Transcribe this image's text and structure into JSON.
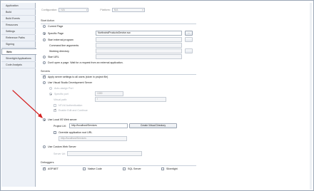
{
  "sidebar": {
    "items": [
      {
        "label": "Application"
      },
      {
        "label": "Build"
      },
      {
        "label": "Build Events"
      },
      {
        "label": "Resources"
      },
      {
        "label": "Settings"
      },
      {
        "label": "Reference Paths"
      },
      {
        "label": "Signing"
      },
      {
        "label": "Web"
      },
      {
        "label": "Silverlight Applications"
      },
      {
        "label": "Code Analysis"
      }
    ],
    "active_index": 7
  },
  "topbar": {
    "configuration_label": "Configuration:",
    "configuration_value": "N/A",
    "platform_label": "Platform:",
    "platform_value": "N/A"
  },
  "start_action": {
    "heading": "Start Action",
    "current_page": "Current Page",
    "specific_page": "Specific Page",
    "specific_page_value": "NorthwindProductsService.svc",
    "browse_label": "...",
    "start_external": "Start external program",
    "command_line": "Command line arguments",
    "working_directory": "Working directory",
    "start_url": "Start URL",
    "dont_open": "Don't open a page.  Wait for a request from an external application."
  },
  "servers": {
    "heading": "Servers",
    "apply_all": "Apply server settings to all users (store in project file)",
    "use_vs_dev": "Use Visual Studio Development Server",
    "auto_assign": "Auto-assign Port",
    "specific_port": "Specific port",
    "specific_port_value": "1330",
    "virtual_path": "Virtual path:",
    "virtual_path_value": "/",
    "ntlm": "NTLM Authentication",
    "edit_continue": "Enable Edit and Continue",
    "use_iis": "Use Local IIS Web server",
    "project_url_label": "Project Url:",
    "project_url_value": "http://localhost/Services",
    "create_vdir": "Create Virtual Directory",
    "override_root": "Override application root URL",
    "override_value": "http://localhost/Services",
    "use_custom": "Use Custom Web Server",
    "server_url_label": "Server Url:"
  },
  "debuggers": {
    "heading": "Debuggers",
    "aspnet": "ASP.NET",
    "native": "Native Code",
    "sql": "SQL Server",
    "silverlight": "Silverlight"
  },
  "colors": {
    "annotation_arrow": "#d42020",
    "sidebar_bg": "#edf1f7"
  }
}
